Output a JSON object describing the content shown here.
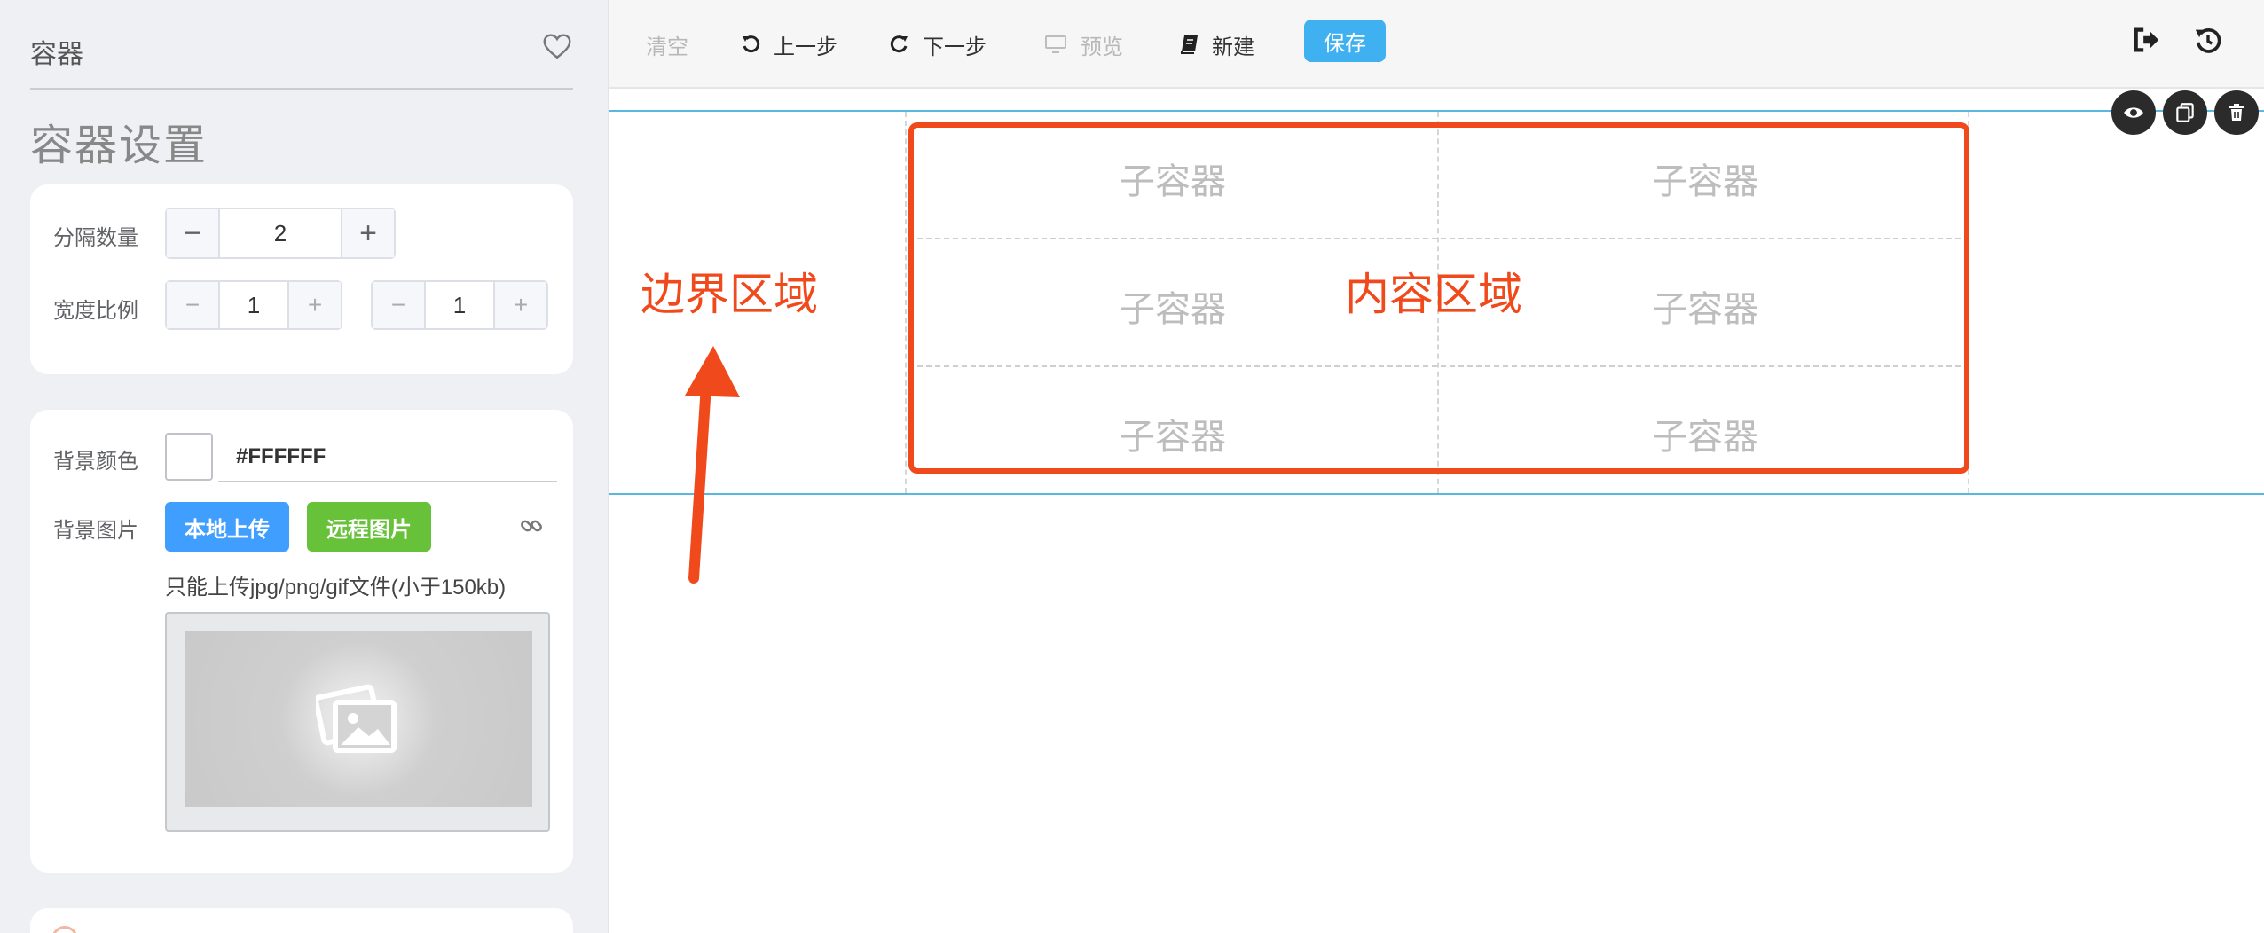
{
  "sidebar": {
    "header_title": "容器",
    "panel_title": "容器设置",
    "split_count": {
      "label": "分隔数量",
      "value": "2",
      "minus": "−",
      "plus": "+"
    },
    "width_ratio": {
      "label": "宽度比例",
      "values": [
        "1",
        "1"
      ],
      "minus": "−",
      "plus": "+"
    },
    "bg_color": {
      "label": "背景颜色",
      "value": "#FFFFFF"
    },
    "bg_image": {
      "label": "背景图片",
      "local_upload": "本地上传",
      "remote_image": "远程图片",
      "hint": "只能上传jpg/png/gif文件(小于150kb)"
    }
  },
  "toolbar": {
    "clear": "清空",
    "undo": "上一步",
    "redo": "下一步",
    "preview": "预览",
    "new": "新建",
    "save": "保存"
  },
  "canvas": {
    "cells": [
      "子容器",
      "子容器",
      "子容器",
      "子容器",
      "子容器",
      "子容器"
    ],
    "annotation_border": "边界区域",
    "annotation_content": "内容区域"
  },
  "colors": {
    "accent": "#409eff",
    "success": "#67c23a",
    "save": "#3fb0f0",
    "annotation": "#f04a1c",
    "guide": "#58b8e0"
  },
  "icons": [
    "heart-icon",
    "link-icon",
    "image-icon",
    "undo-icon",
    "redo-icon",
    "monitor-icon",
    "book-icon",
    "exit-icon",
    "history-icon",
    "eye-icon",
    "copy-icon",
    "trash-icon"
  ]
}
